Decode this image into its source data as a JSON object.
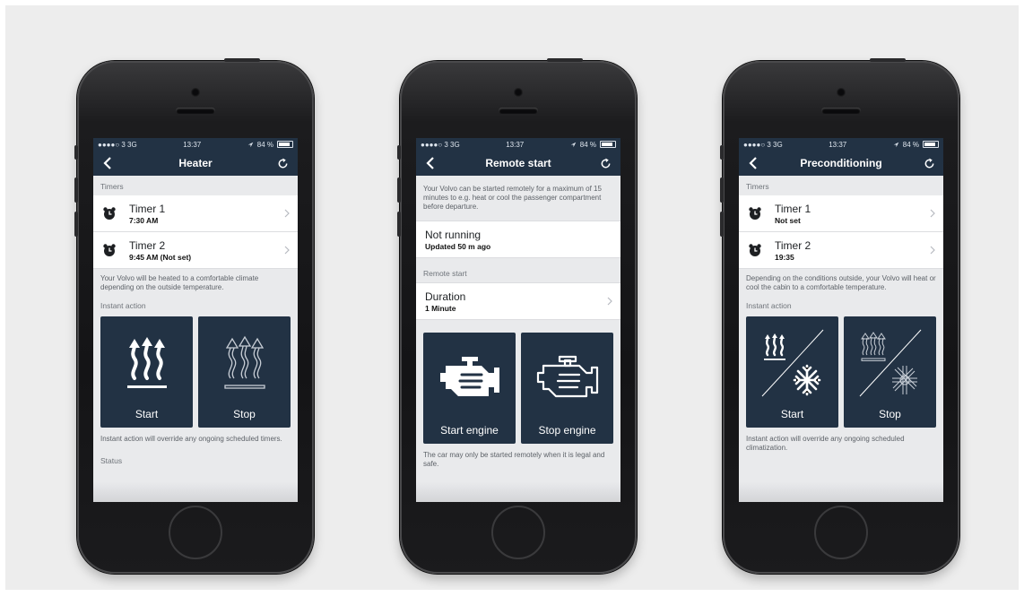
{
  "status": {
    "carrier": "●●●●○ 3  3G",
    "time": "13:37",
    "battery_text": "84 %",
    "battery_level": 0.84
  },
  "heater": {
    "title": "Heater",
    "timers_label": "Timers",
    "timer1_name": "Timer 1",
    "timer1_value": "7:30 AM",
    "timer2_name": "Timer 2",
    "timer2_value": "9:45 AM (Not set)",
    "description": "Your Volvo will be heated to a comfortable climate depending on the outside temperature.",
    "instant_label": "Instant action",
    "start_label": "Start",
    "stop_label": "Stop",
    "note": "Instant action will override any ongoing scheduled timers.",
    "status_label": "Status"
  },
  "remote": {
    "title": "Remote start",
    "description": "Your Volvo can be started remotely for a maximum of 15 minutes to e.g. heat or cool the passenger compartment before departure.",
    "state_main": "Not running",
    "state_sub": "Updated 50 m ago",
    "section_label": "Remote start",
    "duration_name": "Duration",
    "duration_value": "1 Minute",
    "start_label": "Start engine",
    "stop_label": "Stop engine",
    "note": "The car may only be started remotely when it is legal and safe."
  },
  "precond": {
    "title": "Preconditioning",
    "timers_label": "Timers",
    "timer1_name": "Timer 1",
    "timer1_value": "Not set",
    "timer2_name": "Timer 2",
    "timer2_value": "19:35",
    "description": "Depending on the conditions outside, your Volvo will heat or cool the cabin to a comfortable temperature.",
    "instant_label": "Instant action",
    "start_label": "Start",
    "stop_label": "Stop",
    "note": "Instant action will override any ongoing scheduled climatization."
  },
  "colors": {
    "navbar": "#223244",
    "tile": "#223244",
    "screen_bg": "#e9eaec"
  },
  "icons": {
    "back": "chevron-left-icon",
    "refresh": "refresh-icon",
    "row_chevron": "chevron-right-icon",
    "timer": "alarm-clock-icon",
    "heat": "heat-waves-icon",
    "engine": "engine-icon",
    "snowflake": "snowflake-icon"
  }
}
